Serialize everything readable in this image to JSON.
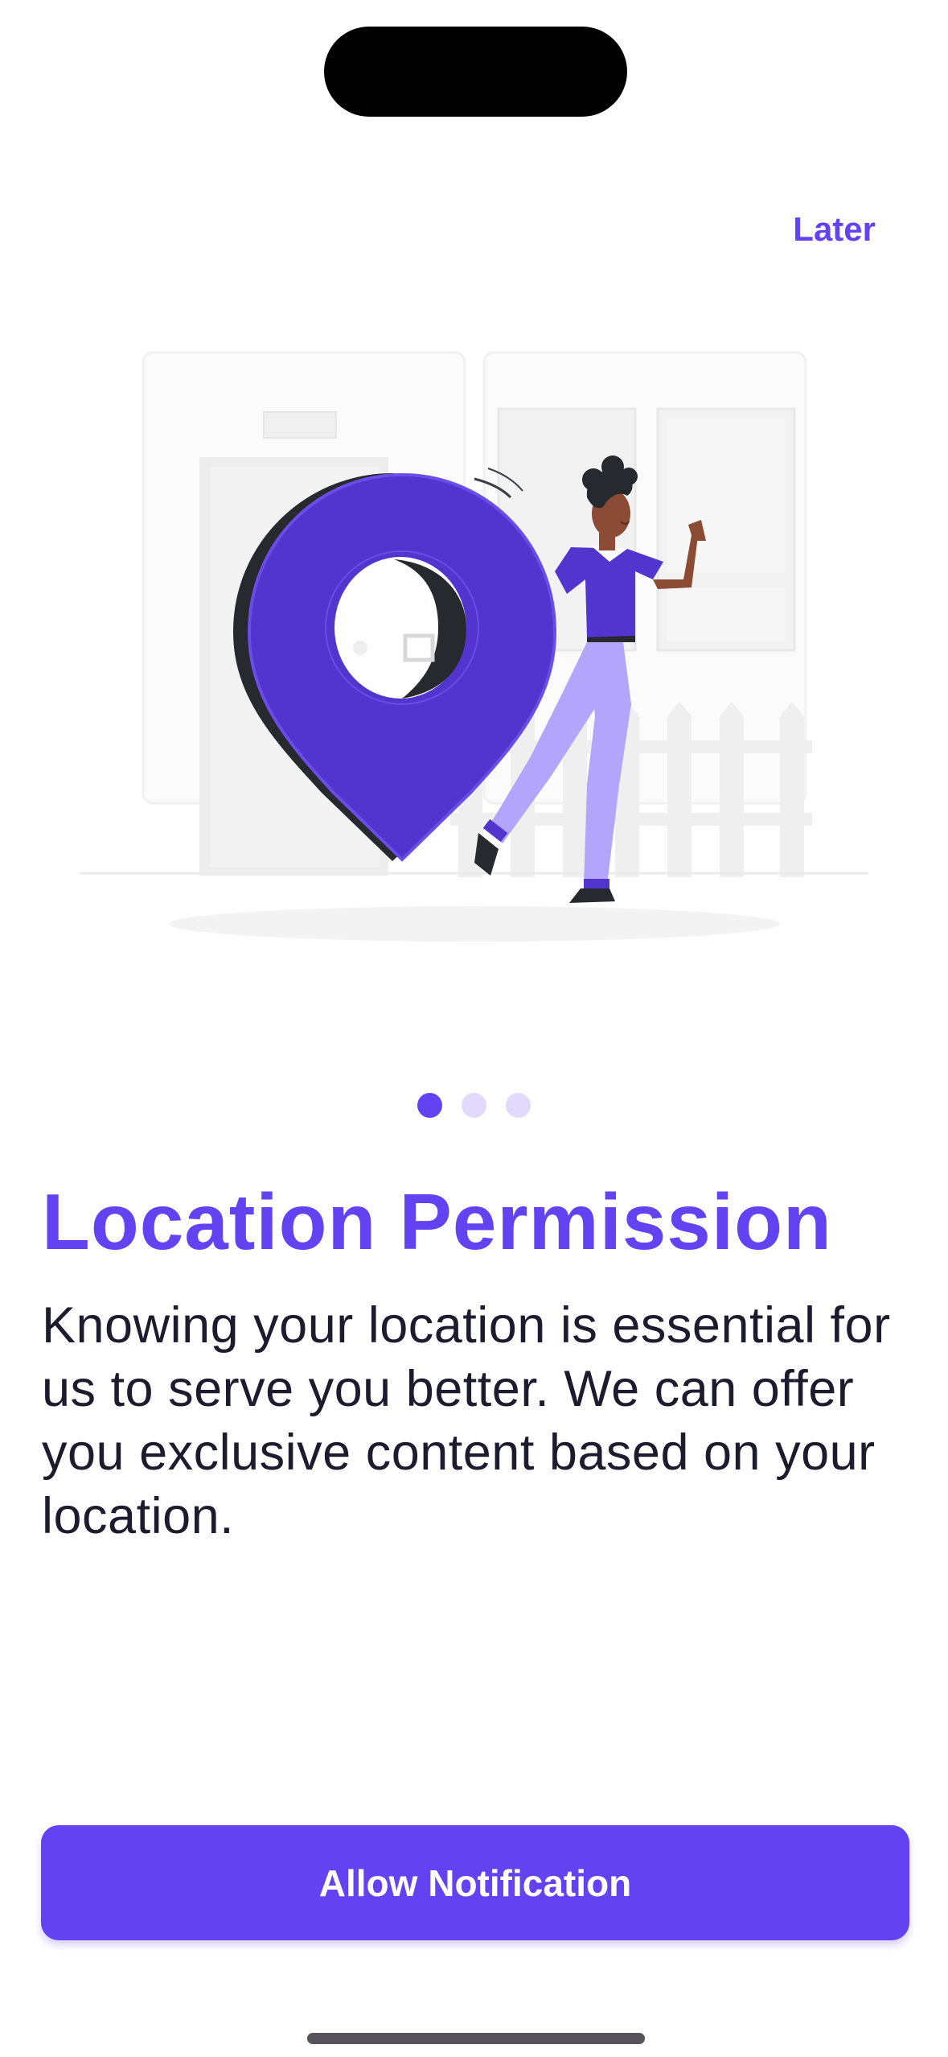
{
  "header": {
    "later_label": "Later"
  },
  "onboarding": {
    "title": "Location Permission",
    "description": "Knowing your location is essential for us to serve you better. We can offer you exclusive content based on your location.",
    "page_indicator": {
      "current": 1,
      "total": 3
    },
    "illustration_icon": "location-pin-illustration"
  },
  "actions": {
    "allow_label": "Allow Notification"
  },
  "colors": {
    "accent": "#6342f2",
    "accent_light": "#e1dafd",
    "text": "#1d1b2e",
    "pin_dark": "#2b2f33",
    "pants": "#b3a5fb",
    "skin": "#8c4b34"
  }
}
